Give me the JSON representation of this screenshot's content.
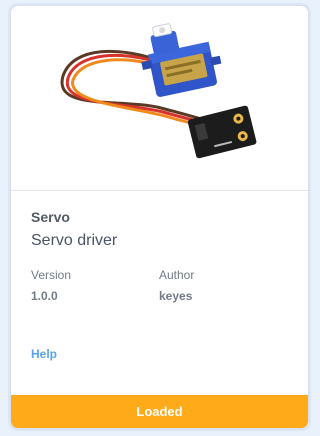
{
  "extension": {
    "name": "Servo",
    "description": "Servo driver",
    "image_icon": "servo-motor-module-icon",
    "version_label": "Version",
    "version_value": "1.0.0",
    "author_label": "Author",
    "author_value": "keyes",
    "help_label": "Help",
    "status_label": "Loaded"
  },
  "colors": {
    "status_bar": "#ffab19",
    "help_link": "#5aa3e6",
    "page_background": "#e9f1fc"
  }
}
